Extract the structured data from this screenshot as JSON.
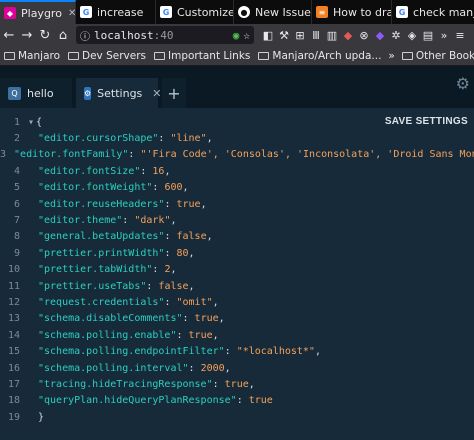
{
  "browser": {
    "tabs": [
      {
        "label": "Playgro",
        "icon": "graphql-icon",
        "close": "✕",
        "active": true
      },
      {
        "label": "increase",
        "icon": "google-icon",
        "active": false
      },
      {
        "label": "Customize",
        "icon": "google-icon",
        "active": false
      },
      {
        "label": "New Issue",
        "icon": "github-icon",
        "active": false
      },
      {
        "label": "How to dra",
        "icon": "stackoverflow-icon",
        "active": false
      },
      {
        "label": "check manj",
        "icon": "google-icon",
        "active": false
      }
    ],
    "url_host": "localhost",
    "url_port": ":40",
    "bookmarks": [
      "Manjaro",
      "Dev Servers",
      "Important Links",
      "Manjaro/Arch upda..."
    ],
    "bookmarks_overflow": "Other Bookmarks"
  },
  "playground": {
    "tabs": [
      {
        "label": "hello",
        "icon": "query-icon",
        "icon_text": "Q"
      },
      {
        "label": "Settings",
        "icon": "settings-icon"
      }
    ],
    "close_symbol": "✕",
    "add_tab_symbol": "+",
    "save_label": "SAVE SETTINGS"
  },
  "settings_lines": [
    {
      "n": "1",
      "open": "{"
    },
    {
      "n": "2",
      "key": "\"editor.cursorShape\"",
      "value": "\"line\"",
      "vtype": "str",
      "comma": ","
    },
    {
      "n": "3",
      "key": "\"editor.fontFamily\"",
      "value": "\"'Fira Code', 'Consolas', 'Inconsolata', 'Droid Sans Mono',",
      "vtype": "str",
      "comma": ""
    },
    {
      "n": "4",
      "key": "\"editor.fontSize\"",
      "value": "16",
      "vtype": "num",
      "comma": ","
    },
    {
      "n": "5",
      "key": "\"editor.fontWeight\"",
      "value": "600",
      "vtype": "num",
      "comma": ","
    },
    {
      "n": "6",
      "key": "\"editor.reuseHeaders\"",
      "value": "true",
      "vtype": "kw",
      "comma": ","
    },
    {
      "n": "7",
      "key": "\"editor.theme\"",
      "value": "\"dark\"",
      "vtype": "str",
      "comma": ","
    },
    {
      "n": "8",
      "key": "\"general.betaUpdates\"",
      "value": "false",
      "vtype": "kw",
      "comma": ","
    },
    {
      "n": "9",
      "key": "\"prettier.printWidth\"",
      "value": "80",
      "vtype": "num",
      "comma": ","
    },
    {
      "n": "10",
      "key": "\"prettier.tabWidth\"",
      "value": "2",
      "vtype": "num",
      "comma": ","
    },
    {
      "n": "11",
      "key": "\"prettier.useTabs\"",
      "value": "false",
      "vtype": "kw",
      "comma": ","
    },
    {
      "n": "12",
      "key": "\"request.credentials\"",
      "value": "\"omit\"",
      "vtype": "str",
      "comma": ","
    },
    {
      "n": "13",
      "key": "\"schema.disableComments\"",
      "value": "true",
      "vtype": "kw",
      "comma": ","
    },
    {
      "n": "14",
      "key": "\"schema.polling.enable\"",
      "value": "true",
      "vtype": "kw",
      "comma": ","
    },
    {
      "n": "15",
      "key": "\"schema.polling.endpointFilter\"",
      "value": "\"*localhost*\"",
      "vtype": "str",
      "comma": ","
    },
    {
      "n": "16",
      "key": "\"schema.polling.interval\"",
      "value": "2000",
      "vtype": "num",
      "comma": ","
    },
    {
      "n": "17",
      "key": "\"tracing.hideTracingResponse\"",
      "value": "true",
      "vtype": "kw",
      "comma": ","
    },
    {
      "n": "18",
      "key": "\"queryPlan.hideQueryPlanResponse\"",
      "value": "true",
      "vtype": "kw",
      "comma": ""
    },
    {
      "n": "19",
      "close": "}"
    }
  ],
  "colors": {
    "editor_bg": "#172a3a",
    "key": "#2bcfbf",
    "value": "#f4a25b",
    "accent": "#0a84ff"
  }
}
